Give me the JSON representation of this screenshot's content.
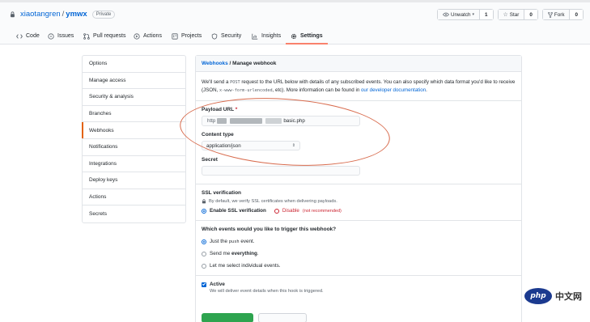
{
  "repo": {
    "owner": "xiaotangren",
    "separator": "/",
    "name": "ymwx",
    "visibility": "Private"
  },
  "repo_actions": [
    {
      "label": "Unwatch",
      "count": "1",
      "icon": "eye-icon"
    },
    {
      "label": "Star",
      "count": "0",
      "icon": "star-icon"
    },
    {
      "label": "Fork",
      "count": "0",
      "icon": "fork-icon"
    }
  ],
  "tabs": [
    {
      "label": "Code",
      "icon": "code-icon"
    },
    {
      "label": "Issues",
      "icon": "issue-icon"
    },
    {
      "label": "Pull requests",
      "icon": "pull-request-icon"
    },
    {
      "label": "Actions",
      "icon": "play-icon"
    },
    {
      "label": "Projects",
      "icon": "project-icon"
    },
    {
      "label": "Security",
      "icon": "shield-icon"
    },
    {
      "label": "Insights",
      "icon": "graph-icon"
    },
    {
      "label": "Settings",
      "icon": "gear-icon",
      "active": true
    }
  ],
  "sidebar": {
    "items": [
      {
        "label": "Options"
      },
      {
        "label": "Manage access"
      },
      {
        "label": "Security & analysis"
      },
      {
        "label": "Branches"
      },
      {
        "label": "Webhooks",
        "selected": true
      },
      {
        "label": "Notifications"
      },
      {
        "label": "Integrations"
      },
      {
        "label": "Deploy keys"
      },
      {
        "label": "Actions"
      },
      {
        "label": "Secrets"
      }
    ]
  },
  "panel": {
    "breadcrumb_link": "Webhooks",
    "breadcrumb_sep": " / ",
    "breadcrumb_current": "Manage webhook",
    "intro_1": "We'll send a ",
    "intro_code_1": "POST",
    "intro_2": " request to the URL below with details of any subscribed events. You can also specify which data format you'd like to receive (JSON, ",
    "intro_code_2": "x-www-form-urlencoded",
    "intro_3": ", etc). More information can be found in ",
    "intro_link": "our developer documentation",
    "intro_4": ".",
    "payload_label": "Payload URL",
    "required_mark": "*",
    "payload_prefix": "http",
    "payload_suffix": "basic.php",
    "content_type_label": "Content type",
    "content_type_value": "application/json",
    "secret_label": "Secret",
    "ssl_label": "SSL verification",
    "ssl_note": "By default, we verify SSL certificates when delivering payloads.",
    "ssl_enable": "Enable SSL verification",
    "ssl_disable": "Disable",
    "ssl_disable_note": "(not recommended)",
    "events_label": "Which events would you like to trigger this webhook?",
    "event_push_1": "Just the ",
    "event_push_code": "push",
    "event_push_2": " event.",
    "event_all_1": "Send me ",
    "event_all_bold": "everything",
    "event_all_2": ".",
    "event_individual": "Let me select individual events.",
    "active_label": "Active",
    "active_note": "We will deliver event details when this hook is triggered."
  },
  "watermark": {
    "logo": "php",
    "text": "中文网"
  }
}
